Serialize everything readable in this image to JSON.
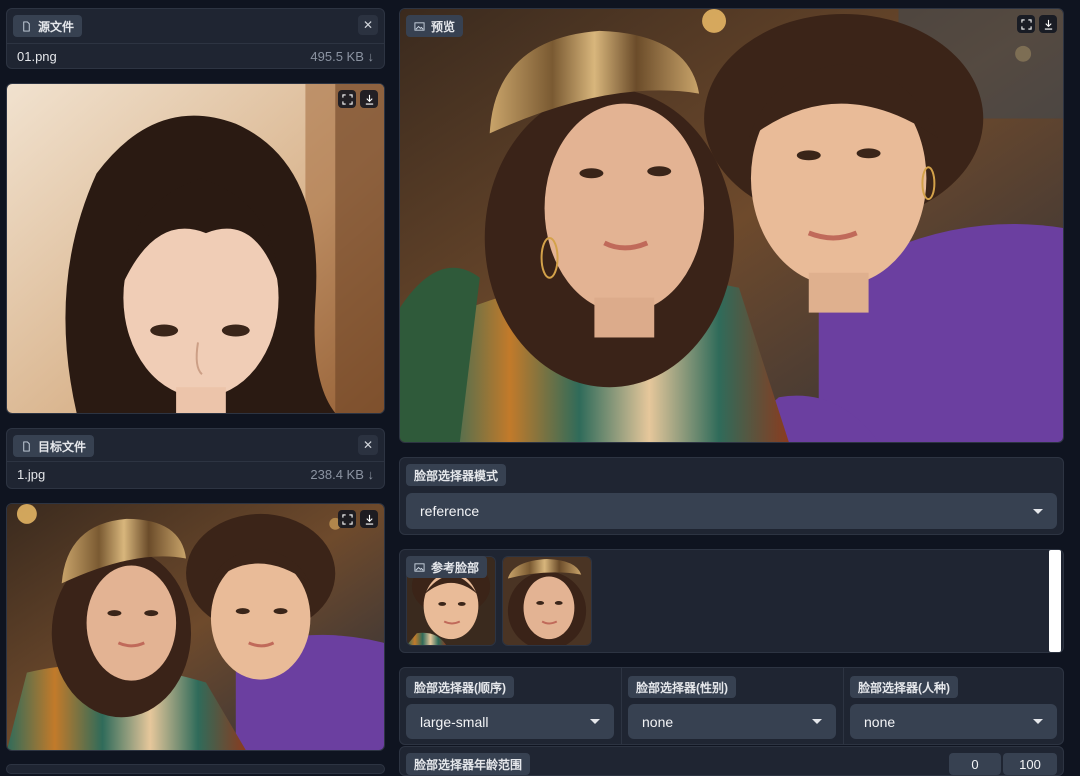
{
  "source_file": {
    "label": "源文件",
    "filename": "01.png",
    "size": "495.5 KB ↓"
  },
  "target_file": {
    "label": "目标文件",
    "filename": "1.jpg",
    "size": "238.4 KB ↓"
  },
  "preview": {
    "label": "预览"
  },
  "face_selector_mode": {
    "label": "脸部选择器模式",
    "value": "reference"
  },
  "reference_faces": {
    "label": "参考脸部"
  },
  "face_selector_order": {
    "label": "脸部选择器(顺序)",
    "value": "large-small"
  },
  "face_selector_gender": {
    "label": "脸部选择器(性别)",
    "value": "none"
  },
  "face_selector_race": {
    "label": "脸部选择器(人种)",
    "value": "none"
  },
  "face_selector_age": {
    "label": "脸部选择器年龄范围",
    "min": "0",
    "max": "100"
  },
  "icons": {
    "file": "file-icon",
    "image": "image-icon",
    "close": "close-icon",
    "fullscreen": "fullscreen-icon",
    "download": "download-icon",
    "dropdown": "chevron-down-icon"
  },
  "colors": {
    "background": "#0f1420",
    "panel": "#1f2532",
    "control": "#374151",
    "accent_purple": "#6b3fa0"
  }
}
